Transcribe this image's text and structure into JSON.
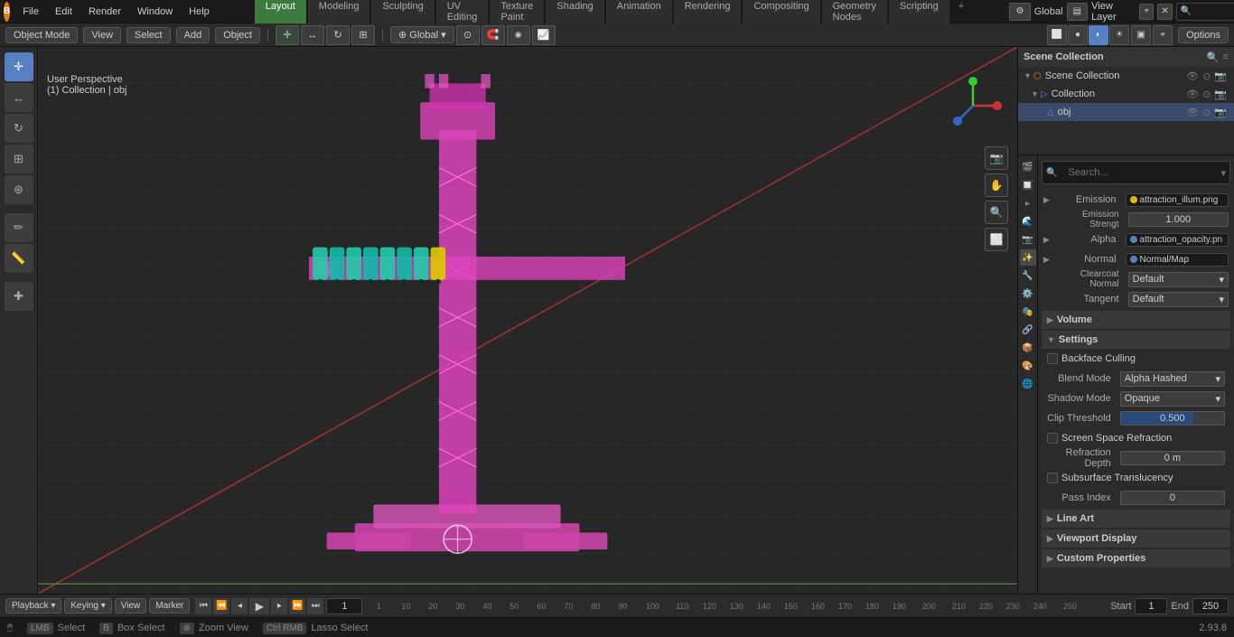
{
  "app": {
    "title": "Blender",
    "version": "2.93.8"
  },
  "top_menu": {
    "items": [
      "File",
      "Edit",
      "Render",
      "Window",
      "Help"
    ]
  },
  "workspace_tabs": {
    "tabs": [
      "Layout",
      "Modeling",
      "Sculpting",
      "UV Editing",
      "Texture Paint",
      "Shading",
      "Animation",
      "Rendering",
      "Compositing",
      "Geometry Nodes",
      "Scripting"
    ],
    "active": "Layout"
  },
  "header": {
    "mode_label": "Object Mode",
    "view_label": "View",
    "select_label": "Select",
    "add_label": "Add",
    "object_label": "Object",
    "global_label": "Global",
    "options_label": "Options"
  },
  "viewport": {
    "info_line1": "User Perspective",
    "info_line2": "(1) Collection | obj",
    "overlay_btn": "Options"
  },
  "outliner": {
    "title": "Scene Collection",
    "items": [
      {
        "label": "Scene Collection",
        "level": 0,
        "icon": "◎"
      },
      {
        "label": "Collection",
        "level": 1,
        "icon": "▷"
      },
      {
        "label": "obj",
        "level": 2,
        "icon": "△"
      }
    ]
  },
  "properties": {
    "search_placeholder": "🔍",
    "sections": {
      "emission": {
        "label": "Emission",
        "rows": [
          {
            "label": "Emission",
            "value": "attraction_illum.png",
            "dot": "yellow"
          },
          {
            "label": "Emission Strengt",
            "value": "1.000"
          }
        ]
      },
      "alpha": {
        "label": "Alpha",
        "value": "attraction_opacity.pn",
        "dot": "blue"
      },
      "normal": {
        "label": "Normal",
        "value": "Normal/Map",
        "dot": "blue"
      },
      "clearcoat_normal": {
        "label": "Clearcoat Normal",
        "value": "Default"
      },
      "tangent": {
        "label": "Tangent",
        "value": "Default"
      },
      "volume": {
        "header": "Volume"
      },
      "settings": {
        "header": "Settings",
        "backface_culling": false,
        "blend_mode": "Alpha Hashed",
        "shadow_mode": "Opaque",
        "clip_threshold": "0.500",
        "screen_space_refraction": false,
        "refraction_depth": "0 m",
        "subsurface_translucency": false,
        "pass_index": "0"
      }
    }
  },
  "timeline": {
    "start": "1",
    "end": "250",
    "current": "1",
    "start_label": "Start",
    "end_label": "End",
    "tabs": [
      "Playback",
      "Keying",
      "View",
      "Marker"
    ],
    "frame_numbers": [
      "1",
      "10",
      "20",
      "30",
      "40",
      "50",
      "60",
      "70",
      "80",
      "90",
      "100",
      "110",
      "120",
      "130",
      "140",
      "150",
      "160",
      "170",
      "180",
      "190",
      "200",
      "210",
      "220",
      "230",
      "240",
      "250"
    ]
  },
  "status_bar": {
    "select_label": "Select",
    "box_select_label": "Box Select",
    "zoom_view_label": "Zoom View",
    "lasso_select_label": "Lasso Select",
    "version": "2.93.8"
  },
  "prop_icons": [
    "🎬",
    "🔲",
    "▸",
    "🌊",
    "📷",
    "✨",
    "🎭",
    "⚙️",
    "🔧",
    "🎨",
    "🌐",
    "📦",
    "🔌"
  ],
  "gizmo": {
    "x_color": "#cc3333",
    "y_color": "#33cc33",
    "z_color": "#3366cc"
  }
}
